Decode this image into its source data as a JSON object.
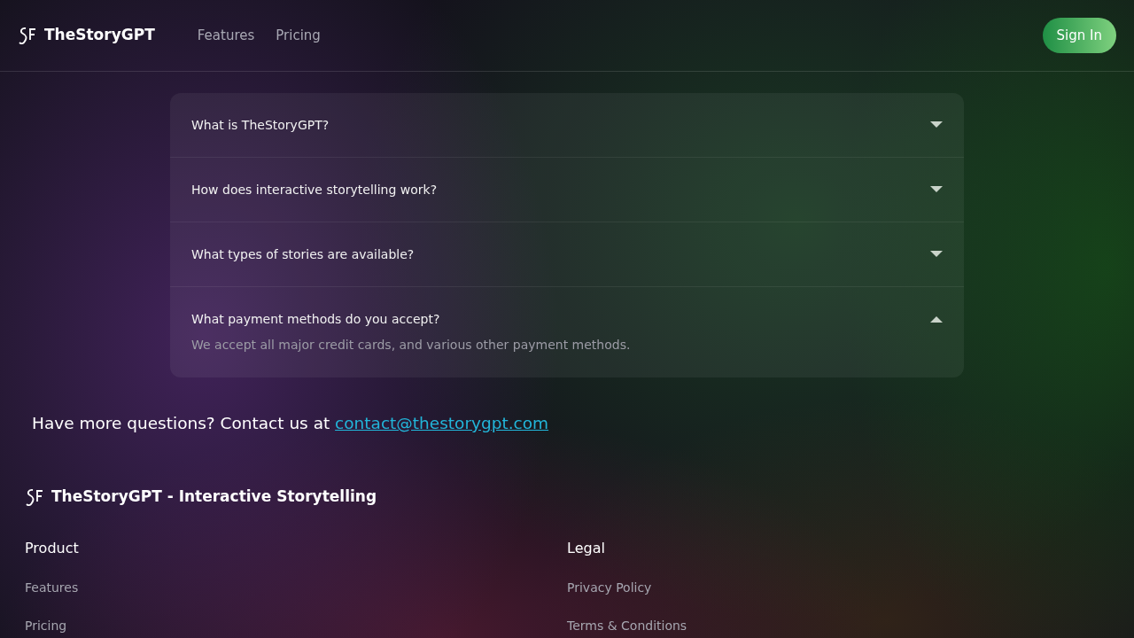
{
  "navbar": {
    "brand": "TheStoryGPT",
    "links": [
      "Features",
      "Pricing"
    ],
    "sign_in": "Sign In"
  },
  "faq": [
    {
      "question": "What is TheStoryGPT?",
      "expanded": false
    },
    {
      "question": "How does interactive storytelling work?",
      "expanded": false
    },
    {
      "question": "What types of stories are available?",
      "expanded": false
    },
    {
      "question": "What payment methods do you accept?",
      "expanded": true,
      "answer": "We accept all major credit cards, and various other payment methods."
    }
  ],
  "contact": {
    "text": "Have more questions? Contact us at",
    "email": "contact@thestorygpt.com"
  },
  "footer": {
    "title": "TheStoryGPT - Interactive Storytelling",
    "columns": [
      {
        "heading": "Product",
        "links": [
          "Features",
          "Pricing"
        ]
      },
      {
        "heading": "Legal",
        "links": [
          "Privacy Policy",
          "Terms & Conditions"
        ]
      }
    ]
  }
}
